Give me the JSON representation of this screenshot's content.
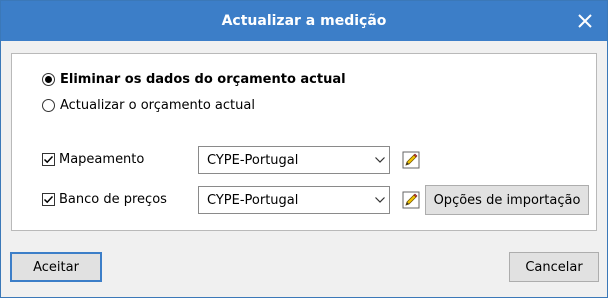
{
  "window": {
    "title": "Actualizar a medição",
    "close_icon": "close-icon"
  },
  "options": {
    "eliminar_label": "Eliminar os dados do orçamento actual",
    "eliminar_selected": true,
    "actualizar_label": "Actualizar o orçamento actual",
    "actualizar_selected": false
  },
  "mapeamento": {
    "label": "Mapeamento",
    "checked": true,
    "value": "CYPE-Portugal"
  },
  "banco": {
    "label": "Banco de preços",
    "checked": true,
    "value": "CYPE-Portugal"
  },
  "buttons": {
    "import_options": "Opções de importação",
    "accept": "Aceitar",
    "cancel": "Cancelar"
  },
  "colors": {
    "titlebar": "#3c7ec8",
    "accent": "#3c7ec8"
  }
}
